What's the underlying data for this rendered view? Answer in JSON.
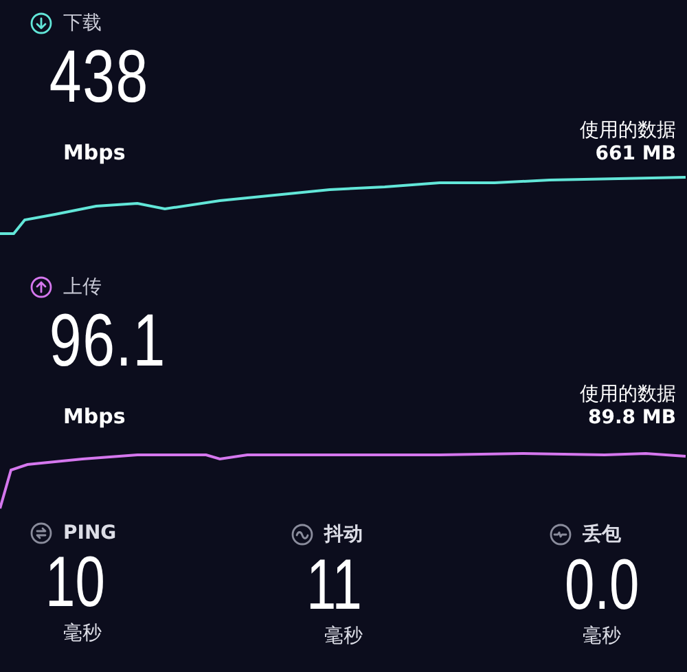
{
  "download": {
    "label": "下载",
    "value": "438",
    "unit": "Mbps",
    "data_label": "使用的数据",
    "data_value": "661 MB"
  },
  "upload": {
    "label": "上传",
    "value": "96.1",
    "unit": "Mbps",
    "data_label": "使用的数据",
    "data_value": "89.8 MB"
  },
  "metrics": [
    {
      "kind": "ping",
      "label": "PING",
      "value": "10",
      "unit": "毫秒"
    },
    {
      "kind": "jitter",
      "label": "抖动",
      "value": "11",
      "unit": "毫秒"
    },
    {
      "kind": "loss",
      "label": "丢包",
      "value": "0.0",
      "unit": "毫秒"
    }
  ]
}
